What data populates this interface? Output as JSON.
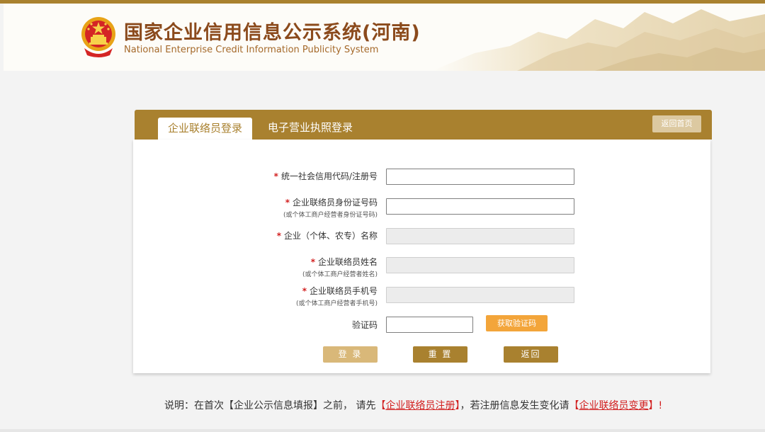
{
  "header": {
    "title_cn": "国家企业信用信息公示系统(河南)",
    "title_en": "National Enterprise Credit Information Publicity System"
  },
  "tabs": [
    {
      "label": "企业联络员登录",
      "active": true
    },
    {
      "label": "电子营业执照登录",
      "active": false
    }
  ],
  "home_button": "返回首页",
  "form": {
    "fields": [
      {
        "label": "统一社会信用代码/注册号",
        "sub": "",
        "required": true,
        "disabled": false,
        "value": ""
      },
      {
        "label": "企业联络员身份证号码",
        "sub": "(或个体工商户经营者身份证号码)",
        "required": true,
        "disabled": false,
        "value": ""
      },
      {
        "label": "企业（个体、农专）名称",
        "sub": "",
        "required": true,
        "disabled": true,
        "value": ""
      },
      {
        "label": "企业联络员姓名",
        "sub": "(或个体工商户经营者姓名)",
        "required": true,
        "disabled": true,
        "value": ""
      },
      {
        "label": "企业联络员手机号",
        "sub": "(或个体工商户经营者手机号)",
        "required": true,
        "disabled": true,
        "value": ""
      }
    ],
    "captcha_label": "验证码",
    "captcha_button": "获取验证码",
    "login_button": "登 录",
    "reset_button": "重 置",
    "back_button": "返回"
  },
  "note": {
    "prefix": "说明：在首次【企业公示信息填报】之前，  请先",
    "link1_open": "【",
    "link1": "企业联络员注册",
    "link1_close": "】",
    "middle": "，若注册信息发生变化请",
    "link2_open": "【",
    "link2": "企业联络员变更",
    "link2_close": "】!",
    "star": "*"
  },
  "colors": {
    "accent": "#a9812f",
    "required": "#d21f1f",
    "captcha_button": "#f3a53a",
    "title": "#8b4a1c"
  }
}
